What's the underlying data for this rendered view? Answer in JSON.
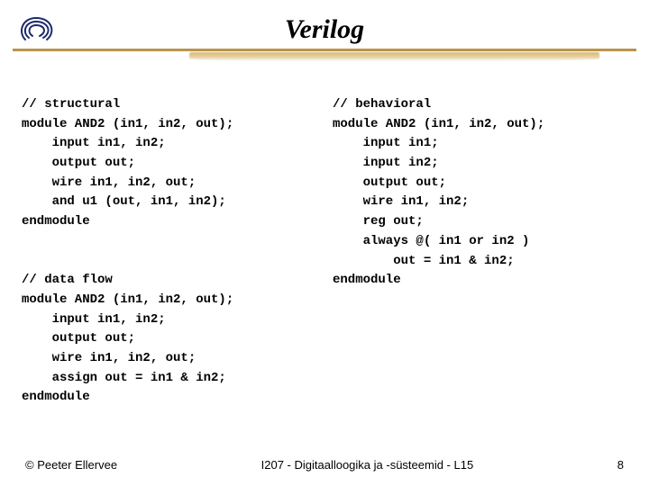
{
  "header": {
    "title": "Verilog"
  },
  "code": {
    "structural": "// structural\nmodule AND2 (in1, in2, out);\n    input in1, in2;\n    output out;\n    wire in1, in2, out;\n    and u1 (out, in1, in2);\nendmodule",
    "dataflow": "// data flow\nmodule AND2 (in1, in2, out);\n    input in1, in2;\n    output out;\n    wire in1, in2, out;\n    assign out = in1 & in2;\nendmodule",
    "behavioral": "// behavioral\nmodule AND2 (in1, in2, out);\n    input in1;\n    input in2;\n    output out;\n    wire in1, in2;\n    reg out;\n    always @( in1 or in2 )\n        out = in1 & in2;\nendmodule"
  },
  "footer": {
    "left": "© Peeter Ellervee",
    "center": "I207 - Digitaalloogika ja -süsteemid - L15",
    "right": "8"
  }
}
